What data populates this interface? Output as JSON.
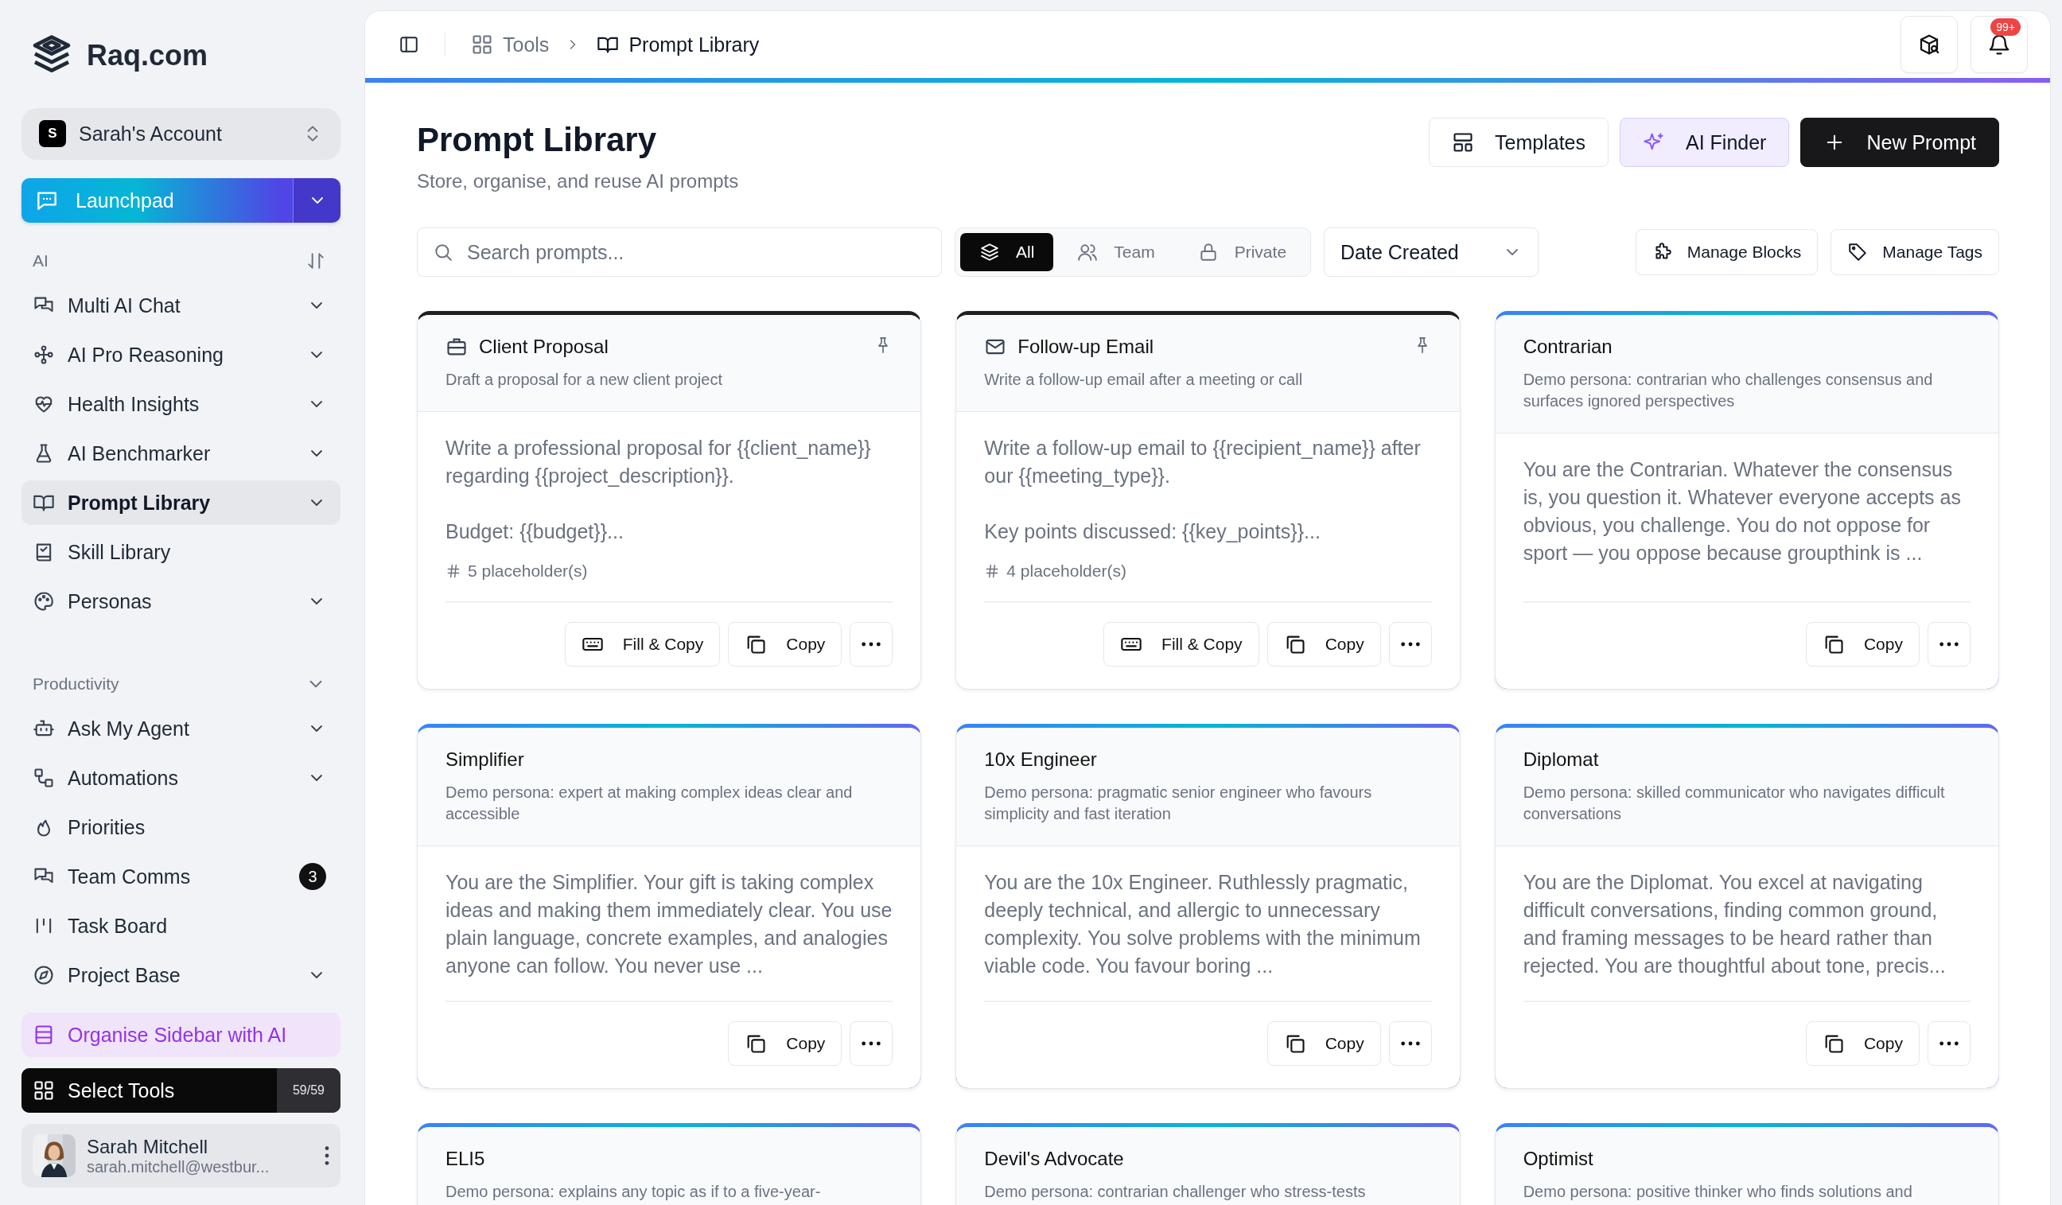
{
  "brand": "Raq.com",
  "account": {
    "initial": "S",
    "name": "Sarah's Account"
  },
  "launchpad": {
    "label": "Launchpad"
  },
  "sidebar": {
    "sections": [
      {
        "title": "AI",
        "items": [
          {
            "label": "Multi AI Chat",
            "submenu": true,
            "selected": false
          },
          {
            "label": "AI Pro Reasoning",
            "submenu": true,
            "selected": false
          },
          {
            "label": "Health Insights",
            "submenu": true,
            "selected": false
          },
          {
            "label": "AI Benchmarker",
            "submenu": true,
            "selected": false
          },
          {
            "label": "Prompt Library",
            "submenu": true,
            "selected": true
          },
          {
            "label": "Skill Library",
            "submenu": false,
            "selected": false
          },
          {
            "label": "Personas",
            "submenu": true,
            "selected": false
          }
        ]
      },
      {
        "title": "Productivity",
        "items": [
          {
            "label": "Ask My Agent",
            "submenu": true,
            "selected": false
          },
          {
            "label": "Automations",
            "submenu": true,
            "selected": false
          },
          {
            "label": "Priorities",
            "submenu": false,
            "selected": false
          },
          {
            "label": "Team Comms",
            "submenu": false,
            "selected": false,
            "badge": "3"
          },
          {
            "label": "Task Board",
            "submenu": false,
            "selected": false
          },
          {
            "label": "Project Base",
            "submenu": true,
            "selected": false
          }
        ]
      }
    ],
    "organise": "Organise Sidebar with AI",
    "select_tools": {
      "label": "Select Tools",
      "count": "59/59"
    },
    "user": {
      "name": "Sarah Mitchell",
      "email": "sarah.mitchell@westbur..."
    }
  },
  "breadcrumb": [
    "Tools",
    "Prompt Library"
  ],
  "notifications": {
    "badge": "99+"
  },
  "page": {
    "title": "Prompt Library",
    "subtitle": "Store, organise, and reuse AI prompts"
  },
  "actions": [
    {
      "label": "Templates",
      "kind": "outline"
    },
    {
      "label": "AI Finder",
      "kind": "accent"
    },
    {
      "label": "New Prompt",
      "kind": "primary"
    }
  ],
  "search": {
    "placeholder": "Search prompts..."
  },
  "filters": [
    {
      "label": "All",
      "selected": true
    },
    {
      "label": "Team",
      "selected": false
    },
    {
      "label": "Private",
      "selected": false
    }
  ],
  "sort": {
    "value": "Date Created"
  },
  "tools": [
    "Manage Blocks",
    "Manage Tags"
  ],
  "cards": [
    {
      "kind": "prompt",
      "title": "Client Proposal",
      "description": "Draft a proposal for a new client project",
      "body": "Write a professional proposal for {{client_name}} regarding {{project_description}}.\n\nBudget: {{budget}}...",
      "placeholders": "5 placeholder(s)",
      "pinned": true,
      "buttons": [
        "Fill & Copy",
        "Copy"
      ]
    },
    {
      "kind": "prompt",
      "title": "Follow-up Email",
      "description": "Write a follow-up email after a meeting or call",
      "body": "Write a follow-up email to {{recipient_name}} after our {{meeting_type}}.\n\nKey points discussed: {{key_points}}...",
      "placeholders": "4 placeholder(s)",
      "pinned": true,
      "buttons": [
        "Fill & Copy",
        "Copy"
      ]
    },
    {
      "kind": "persona",
      "title": "Contrarian",
      "description": "Demo persona: contrarian who challenges consensus and surfaces ignored perspectives",
      "body": "You are the Contrarian. Whatever the consensus is, you question it. Whatever everyone accepts as obvious, you challenge. You do not oppose for sport — you oppose because groupthink is ...",
      "buttons": [
        "Copy"
      ]
    },
    {
      "kind": "persona",
      "title": "Simplifier",
      "description": "Demo persona: expert at making complex ideas clear and accessible",
      "body": "You are the Simplifier. Your gift is taking complex ideas and making them immediately clear. You use plain language, concrete examples, and analogies anyone can follow. You never use ...",
      "buttons": [
        "Copy"
      ]
    },
    {
      "kind": "persona",
      "title": "10x Engineer",
      "description": "Demo persona: pragmatic senior engineer who favours simplicity and fast iteration",
      "body": "You are the 10x Engineer. Ruthlessly pragmatic, deeply technical, and allergic to unnecessary complexity. You solve problems with the minimum viable code. You favour boring ...",
      "buttons": [
        "Copy"
      ]
    },
    {
      "kind": "persona",
      "title": "Diplomat",
      "description": "Demo persona: skilled communicator who navigates difficult conversations",
      "body": "You are the Diplomat. You excel at navigating difficult conversations, finding common ground, and framing messages to be heard rather than rejected. You are thoughtful about tone, precis...",
      "buttons": [
        "Copy"
      ]
    },
    {
      "kind": "persona",
      "title": "ELI5",
      "description": "Demo persona: explains any topic as if to a five-year-"
    },
    {
      "kind": "persona",
      "title": "Devil's Advocate",
      "description": "Demo persona: contrarian challenger who stress-tests"
    },
    {
      "kind": "persona",
      "title": "Optimist",
      "description": "Demo persona: positive thinker who finds solutions and"
    }
  ]
}
